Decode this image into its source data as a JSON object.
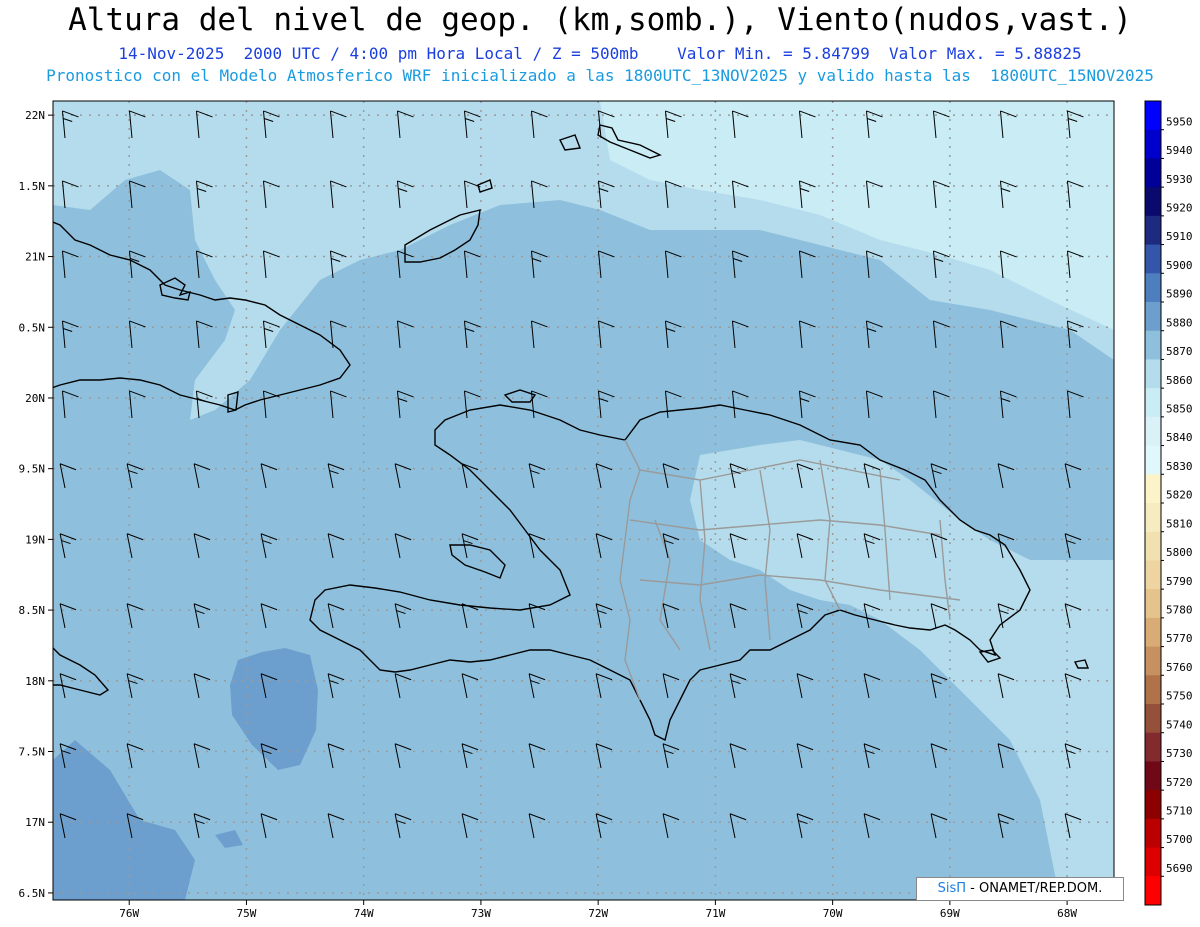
{
  "header": {
    "title": "Altura del nivel de geop. (km,somb.), Viento(nudos,vast.)",
    "line1": "14-Nov-2025  2000 UTC / 4:00 pm Hora Local / Z = 500mb    Valor Min. = 5.84799  Valor Max. = 5.88825",
    "line2": "Pronostico con el Modelo Atmosferico WRF inicializado a las 1800UTC_13NOV2025 y valido hasta las  1800UTC_15NOV2025"
  },
  "credit": {
    "logo": "SisΠ",
    "text": "- ONAMET/REP.DOM."
  },
  "map": {
    "lat_labels": [
      "22N",
      "1.5N",
      "21N",
      "0.5N",
      "20N",
      "9.5N",
      "19N",
      "8.5N",
      "18N",
      "7.5N",
      "17N",
      "6.5N"
    ],
    "lon_labels": [
      "76W",
      "75W",
      "74W",
      "73W",
      "72W",
      "71W",
      "70W",
      "69W",
      "68W"
    ],
    "lat_values": [
      22,
      21.5,
      21,
      20.5,
      20,
      19.5,
      19,
      18.5,
      18,
      17.5,
      17,
      16.5
    ],
    "lon_values": [
      -76,
      -75,
      -74,
      -73,
      -72,
      -71,
      -70,
      -69,
      -68
    ],
    "extent": {
      "lon_min": -76.65,
      "lon_max": -67.6,
      "lat_min": 16.45,
      "lat_max": 22.1
    },
    "shading": {
      "base": "#8ec0dd",
      "regions": [
        {
          "level": "5870-5880",
          "color": "#8ec0dd"
        },
        {
          "level": "5860-5870",
          "color": "#b5dcec"
        },
        {
          "level": "5850-5860",
          "color": "#c9ecf5"
        },
        {
          "level": "5880-5890",
          "color": "#6d9fce"
        }
      ]
    },
    "wind": {
      "barb_color": "#000000",
      "rows": 12,
      "cols": 17
    }
  },
  "legend": {
    "values": [
      5950,
      5940,
      5930,
      5920,
      5910,
      5900,
      5890,
      5880,
      5870,
      5860,
      5850,
      5840,
      5830,
      5820,
      5810,
      5800,
      5790,
      5780,
      5770,
      5760,
      5750,
      5740,
      5730,
      5720,
      5710,
      5700,
      5690
    ],
    "colors": [
      "#0000ff",
      "#0000cc",
      "#000099",
      "#0a0a6e",
      "#1e2a80",
      "#3355aa",
      "#4d7fbf",
      "#6d9fce",
      "#8ec0dd",
      "#b5dcec",
      "#c9ecf5",
      "#daf1f8",
      "#e0f7fb",
      "#fdf3c8",
      "#f7ecc0",
      "#f2e1b0",
      "#edd4a0",
      "#e4c48c",
      "#d8ac74",
      "#c79060",
      "#b07248",
      "#94503a",
      "#822a2e",
      "#700818",
      "#8c0000",
      "#bb0000",
      "#dd0000",
      "#ff0000"
    ]
  }
}
